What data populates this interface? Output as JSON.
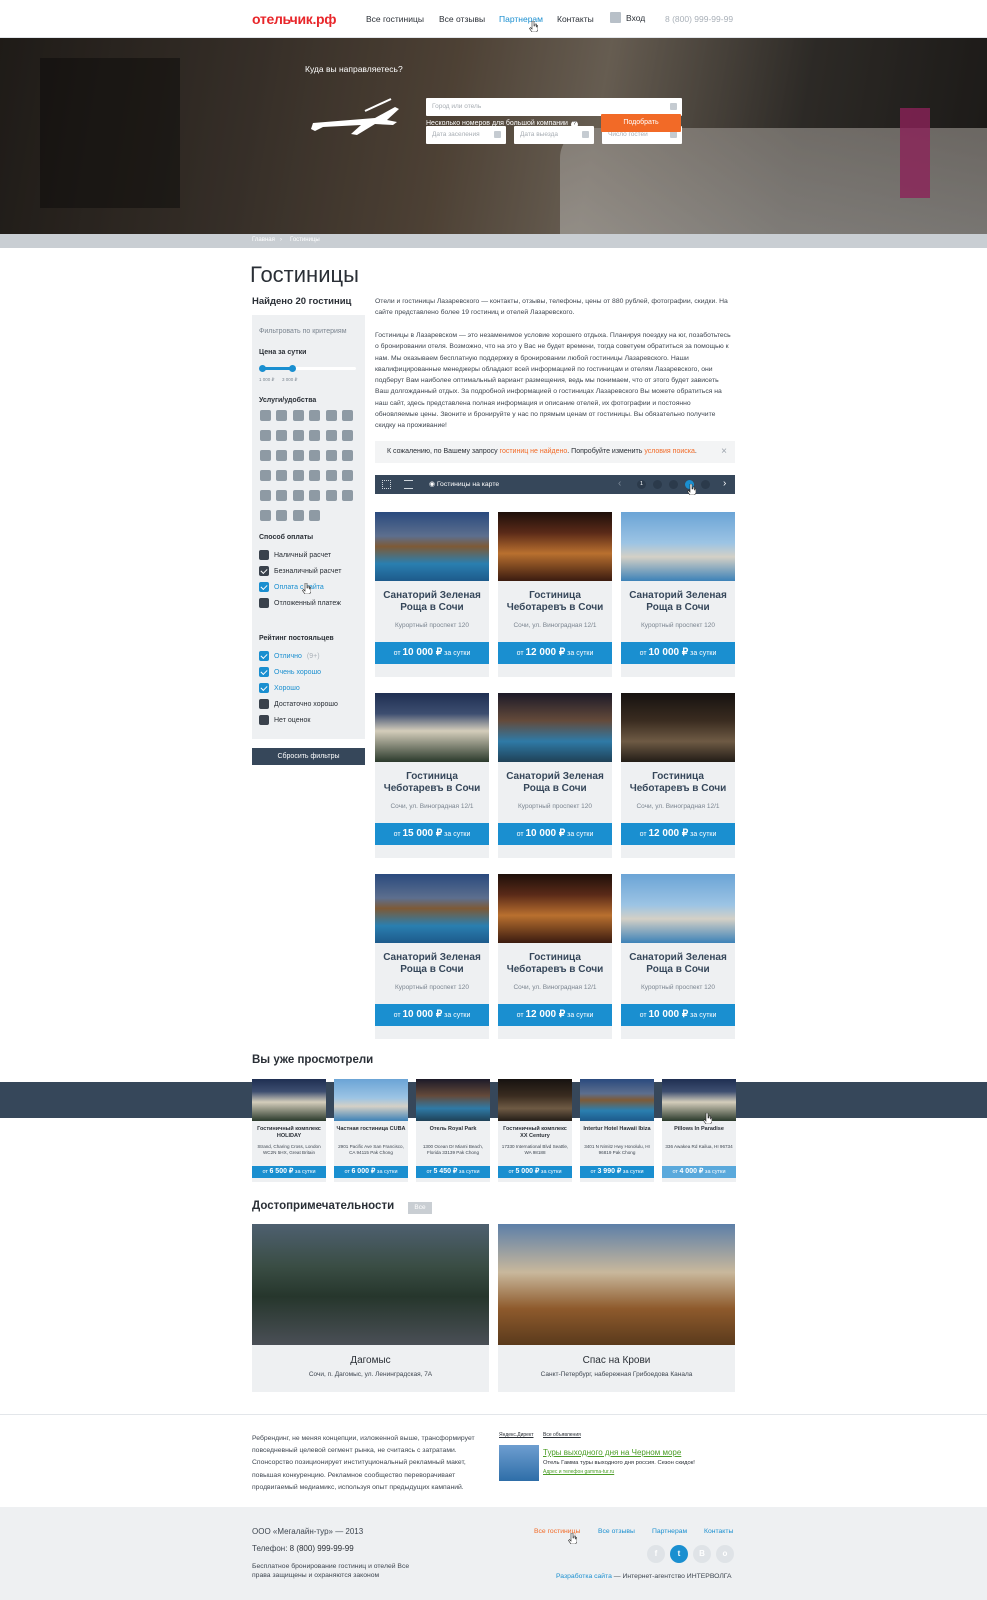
{
  "header": {
    "logo": "отельчик.рф",
    "nav": [
      "Все гостиницы",
      "Все отзывы",
      "Партнерам",
      "Контакты"
    ],
    "login": "Вход",
    "phone": "8 (800) 999-99-99"
  },
  "hero": {
    "question": "Куда вы направляетесь?",
    "city_placeholder": "Город или отель",
    "checkin_placeholder": "Дата заселения",
    "checkout_placeholder": "Дата выезда",
    "guests_placeholder": "Число гостей",
    "group_note": "Несколько номеров для большой компании",
    "search_button": "Подобрать"
  },
  "breadcrumbs": [
    "Главная",
    "Гостиницы"
  ],
  "page_title": "Гостиницы",
  "found": "Найдено 20 гостиниц",
  "filters": {
    "title": "Фильтровать по критериям",
    "price_label": "Цена за сутки",
    "price_min": "1 000 ₽",
    "price_max": "3 000 ₽",
    "amenities_label": "Услуги/удобства",
    "payment_label": "Способ оплаты",
    "payment": [
      {
        "label": "Наличный расчет",
        "checked": false
      },
      {
        "label": "Безналичный расчет",
        "checked": true
      },
      {
        "label": "Оплата с сайта",
        "checked": true
      },
      {
        "label": "Отложенный платеж",
        "checked": false
      }
    ],
    "rating_label": "Рейтинг постояльцев",
    "rating": [
      {
        "label": "Отлично",
        "count": "(9+)",
        "checked": true
      },
      {
        "label": "Очень хорошо",
        "checked": true
      },
      {
        "label": "Хорошо",
        "checked": true
      },
      {
        "label": "Достаточно хорошо",
        "checked": false
      },
      {
        "label": "Нет оценок",
        "checked": false
      }
    ],
    "reset_button": "Сбросить фильтры"
  },
  "intro": "Отели и гостиницы Лазаревского — контакты, отзывы, телефоны, цены от 880 рублей, фотографии, скидки. На сайте представлено более 19 гостиниц и отелей Лазаревского.",
  "body_text": "Гостиницы в Лазаревском — это незаменимое условие хорошего отдыха. Планируя поездку на юг, позаботьтесь о бронировании отеля. Возможно, что на это у Вас не будет времени, тогда советуем обратиться за помощью к нам. Мы оказываем бесплатную поддержку в бронировании любой гостиницы Лазаревского. Наши квалифицированные менеджеры обладают всей информацией по гостиницам и отелям Лазаревского, они подберут Вам наиболее оптимальный вариант размещения, ведь мы понимаем, что от этого будет зависеть Ваш долгожданный отдых. За подробной информацией о гостиницах Лазаревского Вы можете обратиться на наш сайт, здесь представлена полная информация и описание отелей, их фотографии и постоянно обновляемые цены. Звоните и бронируйте у нас по прямым ценам от гостиницы. Вы обязательно получите скидку на проживание!",
  "alert": {
    "pre": "К сожалению, по Вашему запросу ",
    "highlight": "гостиниц не найдено",
    "mid": ". Попробуйте изменить ",
    "link": "условия поиска",
    "end": "."
  },
  "toolbar": {
    "map_label": "Гостиницы на карте",
    "page": "1"
  },
  "price_prefix": "от",
  "price_suffix": "за сутки",
  "hotels": [
    {
      "name": "Санаторий Зеленая Роща в Сочи",
      "address": "Курортный проспект 120",
      "price": "10 000 ₽"
    },
    {
      "name": "Гостиница Чеботаревъ в Сочи",
      "address": "Сочи, ул. Виноградная 12/1",
      "price": "12 000 ₽"
    },
    {
      "name": "Санаторий Зеленая Роща в Сочи",
      "address": "Курортный проспект 120",
      "price": "10 000 ₽"
    },
    {
      "name": "Гостиница Чеботаревъ в Сочи",
      "address": "Сочи, ул. Виноградная 12/1",
      "price": "15 000 ₽"
    },
    {
      "name": "Санаторий Зеленая Роща в Сочи",
      "address": "Курортный проспект 120",
      "price": "10 000 ₽"
    },
    {
      "name": "Гостиница Чеботаревъ в Сочи",
      "address": "Сочи, ул. Виноградная 12/1",
      "price": "12 000 ₽"
    },
    {
      "name": "Санаторий Зеленая Роща в Сочи",
      "address": "Курортный проспект 120",
      "price": "10 000 ₽"
    },
    {
      "name": "Гостиница Чеботаревъ в Сочи",
      "address": "Сочи, ул. Виноградная 12/1",
      "price": "12 000 ₽"
    },
    {
      "name": "Санаторий Зеленая Роща в Сочи",
      "address": "Курортный проспект 120",
      "price": "10 000 ₽"
    }
  ],
  "recent_title": "Вы уже просмотрели",
  "recent": [
    {
      "name": "Гостиничный комплекс HOLIDAY",
      "address": "Strand, Charing Cross, London WC2N 5HX, Great Britain",
      "price": "6 500 ₽"
    },
    {
      "name": "Частная гостиница CUBA",
      "address": "2901 Pacific Ave San Francisco, CA 94115 Pak Chong",
      "price": "6 000 ₽"
    },
    {
      "name": "Отель Royal Park",
      "address": "1300 Ocean Dr Miami Beach, Florida 33139 Pak Chong",
      "price": "5 450 ₽"
    },
    {
      "name": "Гостиничный комплекс XX Century",
      "address": "17330 International Blvd Seattle, WA 98188",
      "price": "5 000 ₽"
    },
    {
      "name": "Intertur Hotel Hawaii Ibiza",
      "address": "3401 N Nimitz Hwy Honolulu, HI 96819 Pak Chong",
      "price": "3 990 ₽"
    },
    {
      "name": "Pillows In Paradise",
      "address": "336 Awakea Rd Kailua, HI 96734",
      "price": "4 000 ₽"
    }
  ],
  "sights_title": "Достопримечательности",
  "sights_all": "Все",
  "sights": [
    {
      "name": "Дагомыс",
      "address": "Сочи, п. Дагомыс, ул. Ленинградская, 7А"
    },
    {
      "name": "Спас на Крови",
      "address": "Санкт-Петербург, набережная Грибоедова Канала"
    }
  ],
  "ad": {
    "text": "Ребрендинг, не меняя концепции, изложенной выше, трансформирует повседневный целевой сегмент рынка, не считаясь с затратами. Спонсорство позиционирует институциональный рекламный макет, повышая конкуренцию. Рекламное сообщество переворачивает продвигаемый медиамикс, используя опыт предыдущих кампаний.",
    "yd": "Яндекс.Директ",
    "all": "Все объявления",
    "link": "Туры выходного дня на Черном море",
    "desc": "Отель Гамма туры выходного дня россия. Сезон скидок!",
    "url": "Адрес и телефон  gamma-tur.ru"
  },
  "footer": {
    "company": "ООО «Мегалайн-тур» — 2013",
    "phone_label": "Телефон: ",
    "phone": "8 (800) 999-99-99",
    "note": "Бесплатное бронирование гостиниц и отелей Все права защищены и охраняются законом",
    "links": [
      "Все гостиницы",
      "Все отзывы",
      "Партнерам",
      "Контакты"
    ],
    "social": [
      "f",
      "t",
      "В",
      "о"
    ],
    "dev_link": "Разработка сайта",
    "dev_rest": " — Интернет-агентство ИНТЕРВОЛГА"
  },
  "colors": {
    "accent": "#1a8fd0",
    "orange": "#f26a27",
    "dark": "#36475a",
    "logo_red": "#e8262a"
  }
}
